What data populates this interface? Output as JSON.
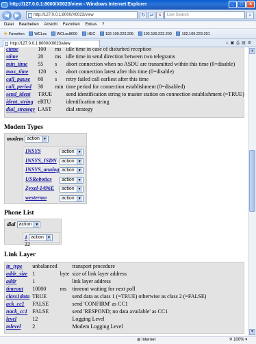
{
  "window": {
    "title": "http://127.0.0.1:8000/X0023/view - Windows Internet Explorer"
  },
  "address": {
    "url": "http://127.0.0.1:8000/X0023/view",
    "search_placeholder": "Live Search"
  },
  "menu": [
    "Datei",
    "Bearbeiten",
    "Ansicht",
    "Favoriten",
    "Extras",
    "?"
  ],
  "favorites": {
    "label": "Favoriten",
    "items": [
      "WCLoc",
      "WCLoc8000",
      "HEC",
      "192.109.223.205",
      "192.109.223.200",
      "192.109.223.201"
    ]
  },
  "tab": {
    "title": "http://127.0.0.1:8000/X0023/view"
  },
  "top_params": [
    {
      "name": "ctime",
      "value": "100",
      "unit": "ms",
      "desc": "idle time in case of disturbed reception"
    },
    {
      "name": "stime",
      "value": "20",
      "unit": "ms",
      "desc": "idle time in send direction between two telegrams"
    },
    {
      "name": "min_time",
      "value": "55",
      "unit": "s",
      "desc": "abort connection when no ASDU are transmitted within this time (0=disable)"
    },
    {
      "name": "max_time",
      "value": "120",
      "unit": "s",
      "desc": "abort connection latest after this time (0=disable)"
    },
    {
      "name": "call_pause",
      "value": "60",
      "unit": "s",
      "desc": "retry failed call earliest after this time"
    },
    {
      "name": "call_period",
      "value": "30",
      "unit": "min",
      "desc": "time period for connection establishment (0=disabled)"
    },
    {
      "name": "send_ident",
      "value": "TRUE",
      "unit": "",
      "desc": "send identification string to master station on connection establishment (=TRUE)"
    },
    {
      "name": "ident_string",
      "value": "eRTU",
      "unit": "",
      "desc": "identification string"
    },
    {
      "name": "dial_strategy",
      "value": "LAST",
      "unit": "",
      "desc": "dial strategy"
    }
  ],
  "modem_types": {
    "title": "Modem Types",
    "label": "modem",
    "select_value": "action",
    "items": [
      "INSYS",
      "INSYS_ISDN",
      "INSYS_analog",
      "USRobotics",
      "Zyxel-1496E",
      "westermo"
    ],
    "item_select_value": "action"
  },
  "phone_list": {
    "title": "Phone List",
    "label": "dial",
    "select_value": "action",
    "entry": {
      "index": "1",
      "select_value": "action",
      "value": "22"
    }
  },
  "link_layer": {
    "title": "Link Layer",
    "params": [
      {
        "name": "tp_type",
        "value": "unbalanced",
        "unit": "",
        "desc": "transport procedure"
      },
      {
        "name": "addr_size",
        "value": "1",
        "unit": "byte",
        "desc": "size of link layer address"
      },
      {
        "name": "addr",
        "value": "1",
        "unit": "",
        "desc": "link layer address"
      },
      {
        "name": "timeout",
        "value": "10000",
        "unit": "ms",
        "desc": "timeout waiting for next poll"
      },
      {
        "name": "class1data",
        "value": "TRUE",
        "unit": "",
        "desc": "send data as class 1 (=TRUE) otherwise as class 2 (=FALSE)"
      },
      {
        "name": "ack_cc1",
        "value": "FALSE",
        "unit": "",
        "desc": "send 'CONFIRM' as CC1"
      },
      {
        "name": "nack_cc1",
        "value": "FALSE",
        "unit": "",
        "desc": "send 'RESPOND; no data available' as CC1"
      },
      {
        "name": "level",
        "value": "12",
        "unit": "",
        "desc": "Logging Level"
      },
      {
        "name": "mlevel",
        "value": "2",
        "unit": "",
        "desc": "Modem Logging Level"
      }
    ]
  },
  "status": {
    "zone": "Internet",
    "zoom": "100%"
  }
}
